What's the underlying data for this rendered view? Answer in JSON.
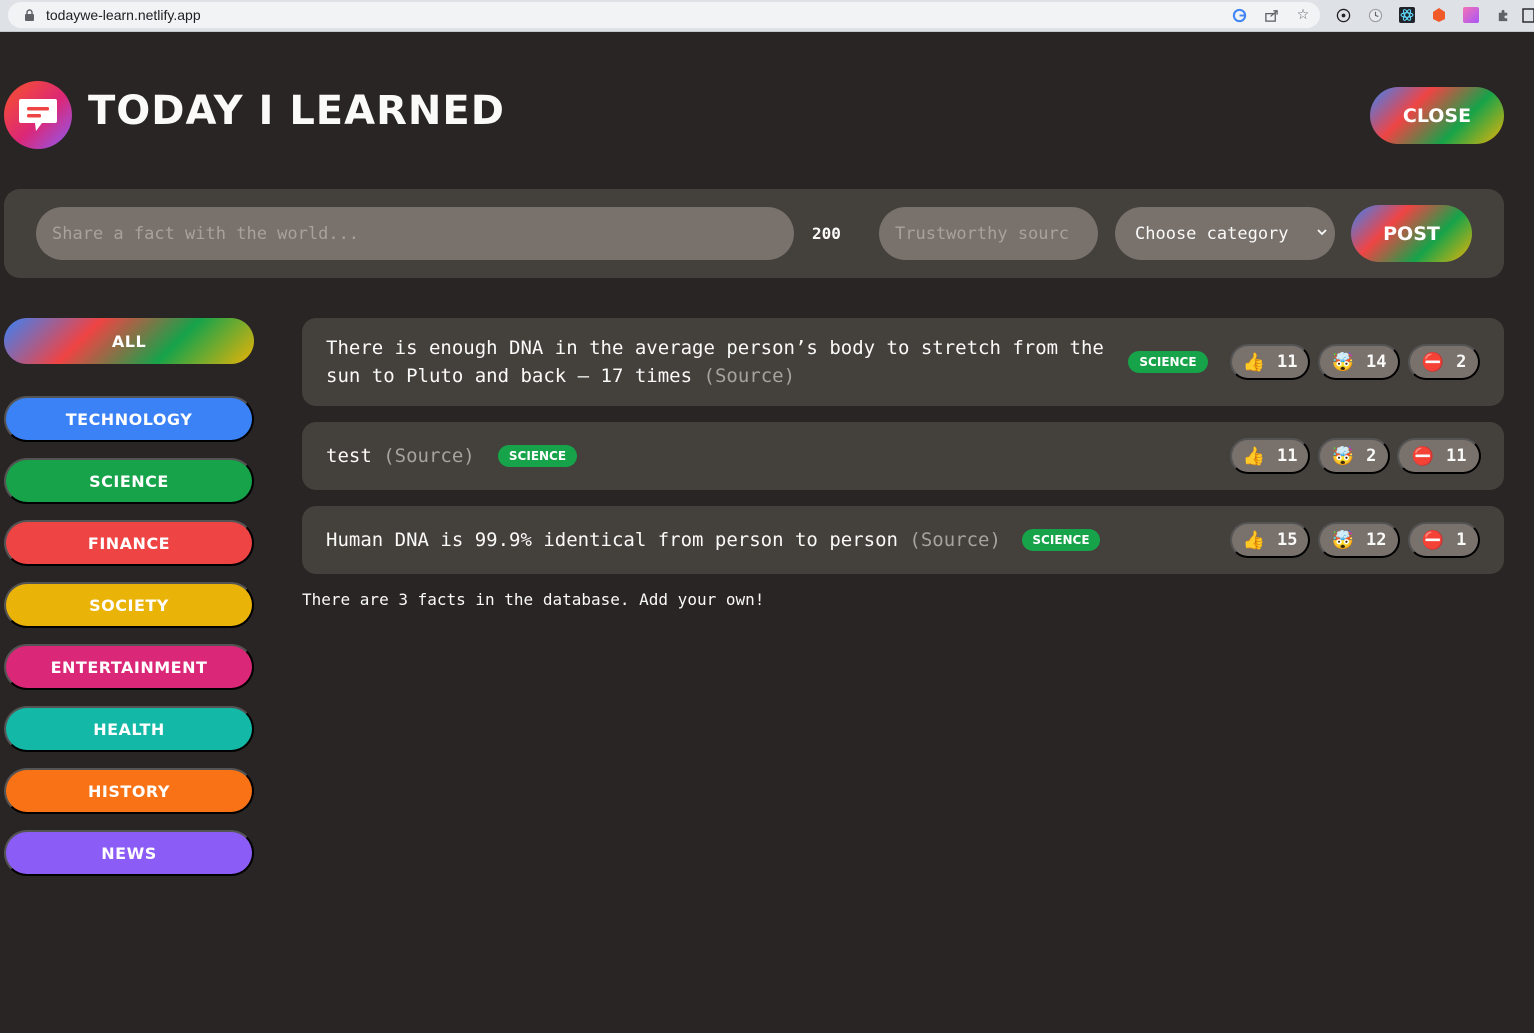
{
  "browser": {
    "url": "todaywe-learn.netlify.app"
  },
  "header": {
    "title": "Today I Learned",
    "close_label": "Close"
  },
  "form": {
    "fact_placeholder": "Share a fact with the world...",
    "char_count": "200",
    "source_placeholder": "Trustworthy sourc",
    "category_selected": "Choose category",
    "post_label": "Post"
  },
  "sidebar": {
    "all_label": "All",
    "categories": [
      {
        "label": "Technology",
        "color": "#3b82f6"
      },
      {
        "label": "Science",
        "color": "#16a34a"
      },
      {
        "label": "Finance",
        "color": "#ef4444"
      },
      {
        "label": "Society",
        "color": "#eab308"
      },
      {
        "label": "Entertainment",
        "color": "#db2777"
      },
      {
        "label": "Health",
        "color": "#14b8a6"
      },
      {
        "label": "History",
        "color": "#f97316"
      },
      {
        "label": "News",
        "color": "#8b5cf6"
      }
    ]
  },
  "facts": [
    {
      "text_line1": "There is enough DNA in the average person’s body to stretch from the",
      "text_line2": "sun to Pluto and back — 17 times",
      "source": "(Source)",
      "category": "Science",
      "votes_interesting": "11",
      "votes_mindblowing": "14",
      "votes_false": "2"
    },
    {
      "text": "test",
      "source": "(Source)",
      "category": "Science",
      "votes_interesting": "11",
      "votes_mindblowing": "2",
      "votes_false": "11"
    },
    {
      "text": "Human DNA is 99.9% identical from person to person",
      "source": "(Source)",
      "category": "Science",
      "votes_interesting": "15",
      "votes_mindblowing": "12",
      "votes_false": "1"
    }
  ],
  "icons": {
    "interesting": "👍",
    "mindblowing": "🤯",
    "false": "⛔"
  },
  "footer": {
    "message": "There are 3 facts in the database. Add your own!"
  },
  "colors": {
    "background": "#292524",
    "panel": "#44403c",
    "input": "#78716c",
    "science_tag": "#16a34a"
  }
}
